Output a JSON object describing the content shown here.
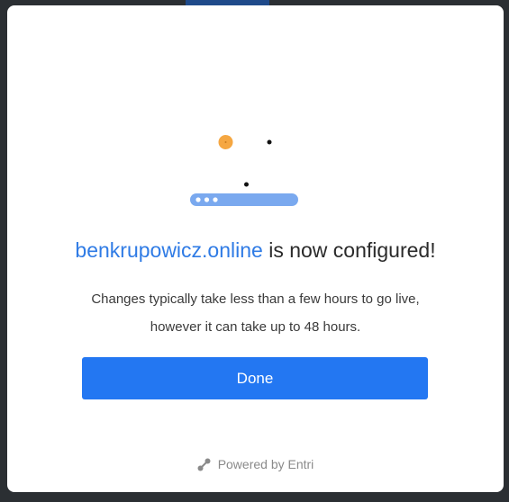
{
  "modal": {
    "title_domain": "benkrupowicz.online",
    "title_suffix": " is now configured!",
    "description": "Changes typically take less than a few hours to go live, however it can take up to 48 hours.",
    "done_label": "Done",
    "powered_by": "Powered by Entri"
  },
  "colors": {
    "accent": "#2377f2",
    "domain_link": "#2f7be5",
    "orange_dot": "#f5a742",
    "server_bar": "#7aa9ef"
  },
  "icons": {
    "illustration": "server-configured-illustration",
    "powered": "entri-logo-icon"
  }
}
